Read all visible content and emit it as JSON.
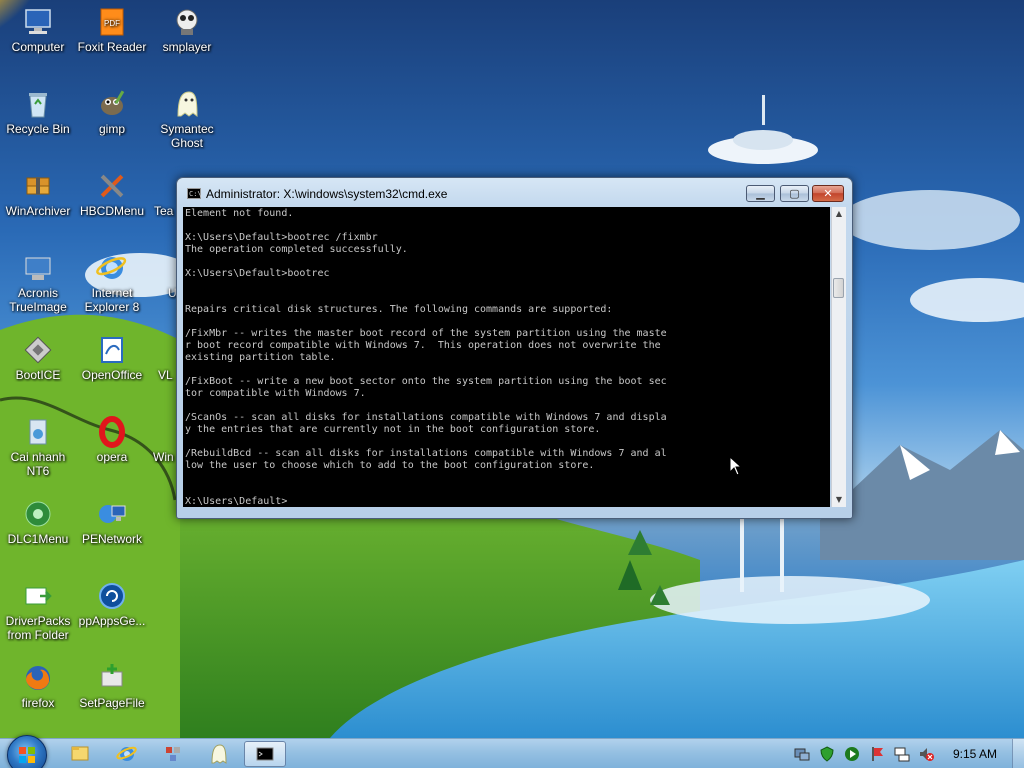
{
  "desktop": {
    "icons": [
      {
        "id": "computer",
        "label": "Computer"
      },
      {
        "id": "foxit",
        "label": "Foxit Reader"
      },
      {
        "id": "smplayer",
        "label": "smplayer"
      },
      {
        "id": "recycle",
        "label": "Recycle Bin"
      },
      {
        "id": "gimp",
        "label": "gimp"
      },
      {
        "id": "symantec",
        "label": "Symantec Ghost"
      },
      {
        "id": "winarchiver",
        "label": "WinArchiver"
      },
      {
        "id": "hbcdmenu",
        "label": "HBCDMenu"
      },
      {
        "id": "teamviewer",
        "label": "Tea"
      },
      {
        "id": "acronis",
        "label": "Acronis TrueImage"
      },
      {
        "id": "ie8",
        "label": "Internet Explorer 8"
      },
      {
        "id": "u-partial",
        "label": "U"
      },
      {
        "id": "bootice",
        "label": "BootICE"
      },
      {
        "id": "openoffice",
        "label": "OpenOffice"
      },
      {
        "id": "vlc",
        "label": "VL"
      },
      {
        "id": "cainhanh",
        "label": "Cai nhanh NT6"
      },
      {
        "id": "opera",
        "label": "opera"
      },
      {
        "id": "win-partial",
        "label": "Win"
      },
      {
        "id": "dlc1menu",
        "label": "DLC1Menu"
      },
      {
        "id": "penetwork",
        "label": "PENetwork"
      },
      {
        "id": "driverpacks",
        "label": "DriverPacks from Folder"
      },
      {
        "id": "ppappsge",
        "label": "ppAppsGe..."
      },
      {
        "id": "firefox",
        "label": "firefox"
      },
      {
        "id": "setpagefile",
        "label": "SetPageFile"
      }
    ]
  },
  "cmd_window": {
    "title": "Administrator: X:\\windows\\system32\\cmd.exe",
    "icon": "cmd-icon",
    "icon_text": "C:\\",
    "minimize_glyph": "▁",
    "maximize_glyph": "▢",
    "close_glyph": "✕",
    "scroll_up_glyph": "▲",
    "scroll_down_glyph": "▼",
    "console_text": "Element not found.\n\nX:\\Users\\Default>bootrec /fixmbr\nThe operation completed successfully.\n\nX:\\Users\\Default>bootrec\n\n\nRepairs critical disk structures. The following commands are supported:\n\n/FixMbr -- writes the master boot record of the system partition using the maste\nr boot record compatible with Windows 7.  This operation does not overwrite the\nexisting partition table.\n\n/FixBoot -- write a new boot sector onto the system partition using the boot sec\ntor compatible with Windows 7.\n\n/ScanOs -- scan all disks for installations compatible with Windows 7 and displa\ny the entries that are currently not in the boot configuration store.\n\n/RebuildBcd -- scan all disks for installations compatible with Windows 7 and al\nlow the user to choose which to add to the boot configuration store.\n\n\nX:\\Users\\Default>"
  },
  "taskbar": {
    "start_icon": "windows-logo-icon",
    "pinned": [
      "explorer-icon",
      "internet-explorer-icon",
      "network-icon",
      "symantec-ghost-icon",
      "cmd-icon"
    ],
    "tray": [
      "computer-tray-icon",
      "shield-icon",
      "play-icon",
      "flag-icon",
      "network-tray-icon",
      "volume-muted-icon"
    ],
    "clock": "9:15 AM"
  },
  "colors": {
    "console_bg": "#000000",
    "console_fg": "#c0c0c0",
    "accent_glass": "#b7cfe8"
  }
}
